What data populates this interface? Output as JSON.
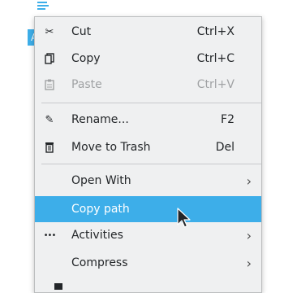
{
  "desktop": {
    "file_label": "A"
  },
  "menu": {
    "groups": {
      "edit": [
        {
          "label": "Cut",
          "shortcut": "Ctrl+X",
          "icon": "scissors-icon"
        },
        {
          "label": "Copy",
          "shortcut": "Ctrl+C",
          "icon": "copy-icon"
        },
        {
          "label": "Paste",
          "shortcut": "Ctrl+V",
          "icon": "clipboard-icon",
          "disabled": true
        }
      ],
      "file": [
        {
          "label": "Rename...",
          "shortcut": "F2",
          "icon": "pencil-icon"
        },
        {
          "label": "Move to Trash",
          "shortcut": "Del",
          "icon": "trash-icon"
        }
      ],
      "actions": [
        {
          "label": "Open With",
          "submenu": true
        },
        {
          "label": "Copy path",
          "highlighted": true
        },
        {
          "label": "Activities",
          "submenu": true,
          "icon": "dots-icon"
        },
        {
          "label": "Compress",
          "submenu": true
        }
      ]
    },
    "submenu_arrow": "›",
    "highlight_color": "#3daee9"
  }
}
